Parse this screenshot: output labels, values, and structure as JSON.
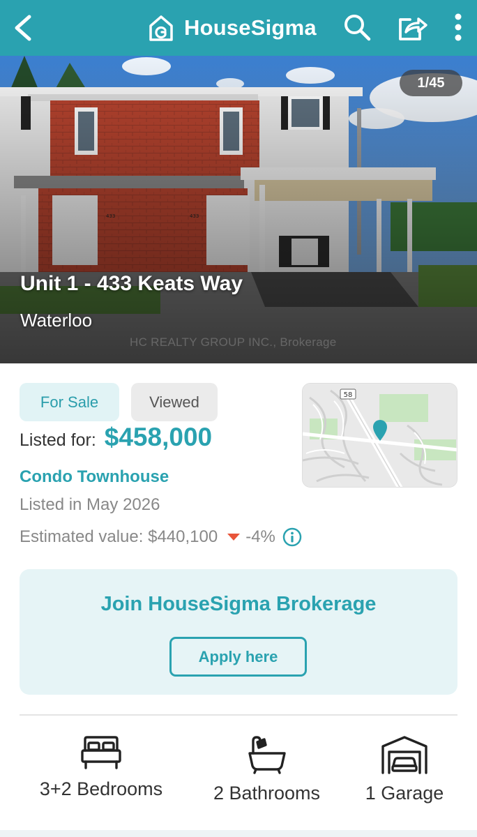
{
  "header": {
    "brand_name": "HouseSigma",
    "icons": [
      "back-arrow-icon",
      "house-logo-icon",
      "search-icon",
      "share-icon",
      "more-vertical-icon"
    ]
  },
  "hero": {
    "photo_counter": "1/45",
    "address": "Unit 1 - 433 Keats Way",
    "city": "Waterloo",
    "watermark": "HC REALTY GROUP INC., Brokerage",
    "unit_numbers": [
      "433",
      "433"
    ]
  },
  "listing": {
    "status_tag": "For Sale",
    "viewed_tag": "Viewed",
    "listed_for_label": "Listed for:",
    "price": "$458,000",
    "property_type": "Condo Townhouse",
    "listed_date": "Listed in May 2026",
    "estimate_label": "Estimated value: $440,100",
    "estimate_change": "-4%"
  },
  "map": {
    "road_label": "58"
  },
  "promo": {
    "title": "Join HouseSigma Brokerage",
    "button_label": "Apply here"
  },
  "features": {
    "bedrooms": "3+2 Bedrooms",
    "bathrooms": "2 Bathrooms",
    "garage": "1 Garage"
  },
  "colors": {
    "accent": "#2aa2b0",
    "decrease": "#e8553a",
    "tag_bg": "#e1f3f5",
    "promo_bg": "#e6f4f6"
  }
}
